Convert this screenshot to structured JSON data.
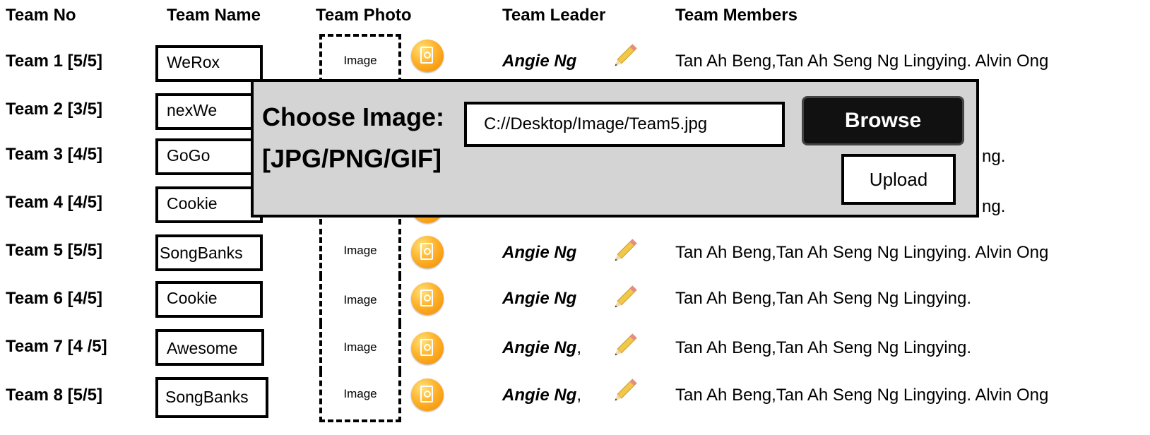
{
  "headers": {
    "team_no": "Team No",
    "team_name": "Team Name",
    "team_photo": "Team Photo",
    "team_leader": "Team Leader",
    "team_members": "Team Members"
  },
  "rows": [
    {
      "team_no": "Team 1 [5/5]",
      "team_name": "WeRox",
      "photo": "Image",
      "leader": "Angie Ng",
      "comma": "",
      "members": "Tan Ah Beng,Tan Ah Seng Ng Lingying. Alvin Ong"
    },
    {
      "team_no": "Team 2 [3/5]",
      "team_name": "nexWe",
      "photo": "",
      "leader": "",
      "comma": "",
      "members": ""
    },
    {
      "team_no": "Team 3 [4/5]",
      "team_name": "GoGo",
      "photo": "",
      "leader": "",
      "comma": "",
      "members": "ng."
    },
    {
      "team_no": "Team 4 [4/5]",
      "team_name": "Cookie",
      "photo": "",
      "leader": "",
      "comma": "",
      "members": "ng."
    },
    {
      "team_no": "Team 5 [5/5]",
      "team_name": "SongBanks",
      "photo": "Image",
      "leader": "Angie Ng",
      "comma": "",
      "members": "Tan Ah Beng,Tan Ah Seng Ng Lingying. Alvin Ong"
    },
    {
      "team_no": "Team 6 [4/5]",
      "team_name": "Cookie",
      "photo": "Image",
      "leader": "Angie Ng",
      "comma": "",
      "members": "Tan Ah Beng,Tan Ah Seng Ng Lingying."
    },
    {
      "team_no": "Team 7 [4 /5]",
      "team_name": "Awesome",
      "photo": "Image",
      "leader": "Angie Ng",
      "comma": ",",
      "members": "Tan Ah Beng,Tan Ah Seng Ng Lingying."
    },
    {
      "team_no": "Team 8 [5/5]",
      "team_name": "SongBanks",
      "photo": "Image",
      "leader": "Angie Ng",
      "comma": ",",
      "members": "Tan Ah Beng,Tan Ah Seng Ng Lingying. Alvin Ong"
    }
  ],
  "icons": {
    "upload": "upload-photo-icon",
    "edit": "pencil-icon"
  },
  "dialog": {
    "title": "Choose Image:",
    "file_types": "[JPG/PNG/GIF]",
    "path_value": "C://Desktop/Image/Team5.jpg",
    "browse_label": "Browse",
    "upload_label": "Upload"
  },
  "colors": {
    "dialog_bg": "#d4d4d4",
    "browse_bg": "#111111",
    "icon_orange": "#f5a01a",
    "pencil_yellow": "#f2c84b"
  }
}
